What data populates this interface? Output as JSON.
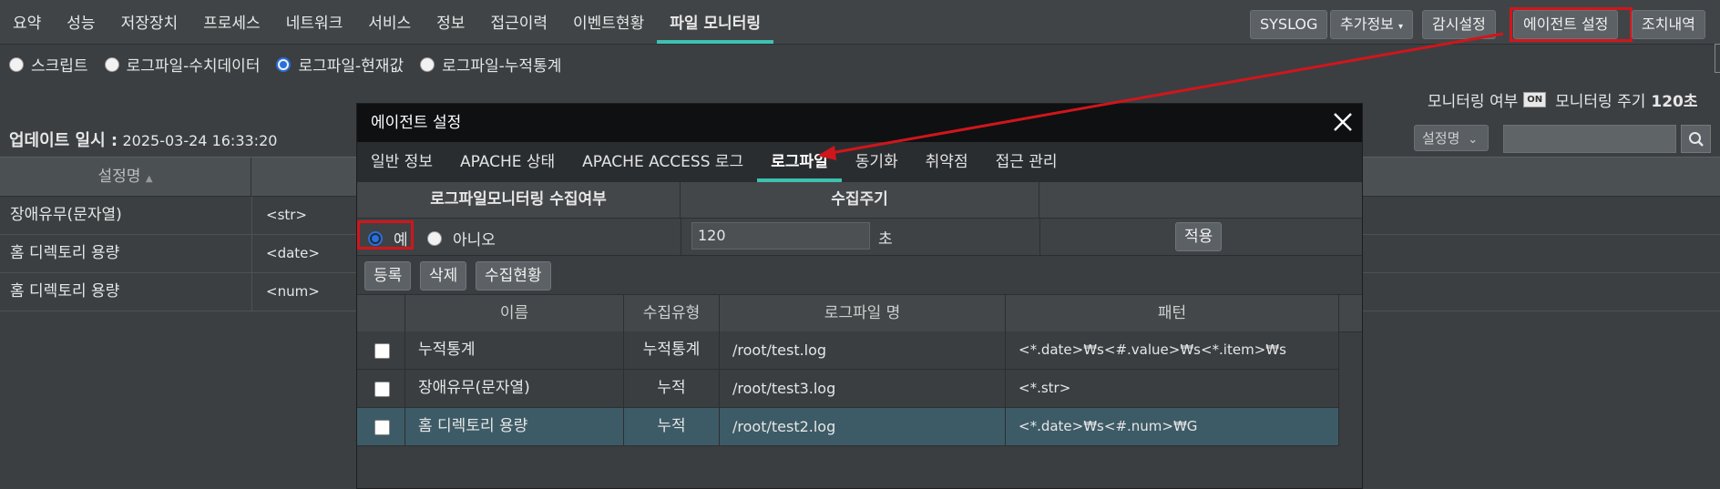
{
  "nav": {
    "items": [
      "요약",
      "성능",
      "저장장치",
      "프로세스",
      "네트워크",
      "서비스",
      "정보",
      "접근이력",
      "이벤트현황",
      "파일 모니터링"
    ],
    "active_index": 9
  },
  "right_buttons": {
    "syslog": "SYSLOG",
    "extra_info": "추가정보",
    "monitor_settings": "감시설정",
    "agent_settings": "에이전트 설정",
    "action_history": "조치내역"
  },
  "mode_radios": {
    "options": [
      "스크립트",
      "로그파일-수치데이터",
      "로그파일-현재값",
      "로그파일-누적통계"
    ],
    "selected_index": 2
  },
  "monitoring": {
    "enabled_label": "모니터링 여부",
    "toggle": "ON",
    "period_label": "모니터링 주기",
    "period_value": "120초"
  },
  "update": {
    "label": "업데이트 일시 :",
    "value": "2025-03-24 16:33:20"
  },
  "filter": {
    "select_value": "설정명",
    "search_placeholder": ""
  },
  "bg_table": {
    "header": "설정명",
    "rows": [
      {
        "name": "장애유무(문자열)",
        "pattern": "<str>"
      },
      {
        "name": "홈 디렉토리 용량",
        "pattern": "<date>"
      },
      {
        "name": "홈 디렉토리 용량",
        "pattern": "<num>"
      }
    ]
  },
  "modal": {
    "title": "에이전트 설정",
    "tabs": [
      "일반 정보",
      "APACHE 상태",
      "APACHE ACCESS 로그",
      "로그파일",
      "동기화",
      "취약점",
      "접근 관리"
    ],
    "active_tab": 3,
    "collect_header": "로그파일모니터링 수집여부",
    "period_header": "수집주기",
    "yes_label": "예",
    "no_label": "아니오",
    "period_value": "120",
    "period_unit": "초",
    "apply_label": "적용",
    "register_label": "등록",
    "delete_label": "삭제",
    "status_label": "수집현황",
    "columns": [
      "이름",
      "수집유형",
      "로그파일 명",
      "패턴"
    ],
    "rows": [
      {
        "name": "누적통계",
        "type": "누적통계",
        "file": "/root/test.log",
        "pattern": "<*.date>₩s<#.value>₩s<*.item>₩s"
      },
      {
        "name": "장애유무(문자열)",
        "type": "누적",
        "file": "/root/test3.log",
        "pattern": "<*.str>"
      },
      {
        "name": "홈 디렉토리 용량",
        "type": "누적",
        "file": "/root/test2.log",
        "pattern": "<*.date>₩s<#.num>₩G"
      }
    ],
    "selected_row": 2
  },
  "colors": {
    "accent": "#3ec1b0",
    "highlight": "#d0161b",
    "selected_row": "#3d5b66"
  }
}
